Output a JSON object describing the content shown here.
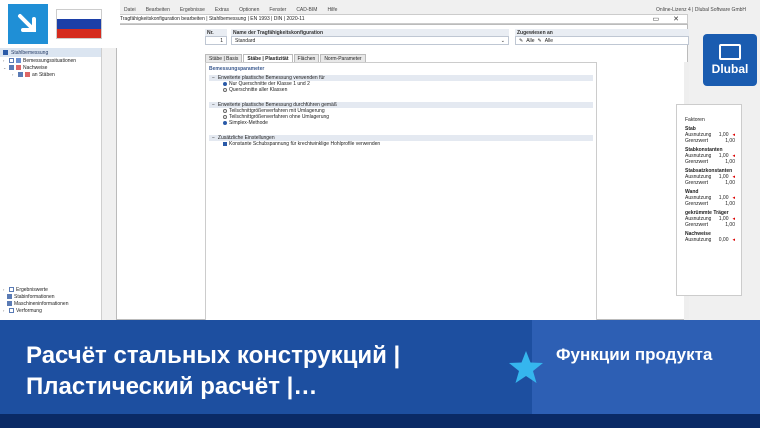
{
  "menubar": [
    "Datei",
    "Bearbeiten",
    "Ergebnisse",
    "Extras",
    "Optionen",
    "Fenster",
    "CAD-BIM",
    "Hilfe"
  ],
  "titlebar": {
    "title": "Tragfähigkeitskonfiguration bearbeiten | Stahlbemessung | EN 1993 | DIN | 2020-11",
    "license": "Online-Lizenz 4 | Dlubal Software GmbH"
  },
  "left_panel": {
    "header": "Stahlbemessung",
    "tree": [
      "Bemessungssituationen",
      "Nachweise",
      "an Stäben"
    ],
    "tree_bottom": [
      "Ergebniswerte",
      "Stabinformationen",
      "Maschineninformationen",
      "Verformung"
    ]
  },
  "dialog": {
    "no_label": "Nr.",
    "no_value": "1",
    "name_label": "Name der Tragfähigkeitskonfiguration",
    "name_value": "Standard",
    "assigned_label": "Zugewiesen an",
    "assigned_value": "Alle",
    "assigned_value2": "Alle",
    "tabs": [
      "Stäbe | Basis",
      "Stäbe | Plastizität",
      "Flächen",
      "Norm-Parameter"
    ],
    "section": "Bemessungsparameter",
    "groups": [
      {
        "title": "Erweiterte plastische Bemessung verwenden für",
        "options": [
          {
            "label": "Nur Querschnitte der Klasse 1 und 2",
            "on": true
          },
          {
            "label": "Querschnitte aller Klassen",
            "on": false
          }
        ]
      },
      {
        "title": "Erweiterte plastische Bemessung durchführen gemäß",
        "options": [
          {
            "label": "Teilschnittgrößenverfahren mit Umlagerung",
            "on": false
          },
          {
            "label": "Teilschnittgrößenverfahren ohne Umlagerung",
            "on": false
          },
          {
            "label": "Simplex-Methode",
            "on": true
          }
        ]
      }
    ],
    "extra_title": "Zusätzliche Einstellungen",
    "extra_check": "Konstante Schubspannung für krechtwinklige Hohlprofile verwenden"
  },
  "right_panel": {
    "title_line": "Faktoren",
    "groups": [
      {
        "name": "Stab",
        "rows": [
          [
            "Ausnutzung",
            "1,00"
          ],
          [
            "Grenzwert",
            "1,00"
          ]
        ]
      },
      {
        "name": "Stabkonstanten",
        "rows": [
          [
            "Ausnutzung",
            "1,00"
          ],
          [
            "Grenzwert",
            "1,00"
          ]
        ]
      },
      {
        "name": "Stabsatzkonstanten",
        "rows": [
          [
            "Ausnutzung",
            "1,00"
          ],
          [
            "Grenzwert",
            "1,00"
          ]
        ]
      },
      {
        "name": "Wand",
        "rows": [
          [
            "Ausnutzung",
            "1,00"
          ],
          [
            "Grenzwert",
            "1,00"
          ]
        ]
      },
      {
        "name": "gekrümmte Träger",
        "rows": [
          [
            "Ausnutzung",
            "1,00"
          ],
          [
            "Grenzwert",
            "1,00"
          ]
        ]
      },
      {
        "name": "Nachweise",
        "rows": [
          [
            "Ausnutzung",
            "0,00"
          ]
        ]
      }
    ]
  },
  "logo": {
    "text": "Dlubal"
  },
  "banner": {
    "title": "Расчёт стальных конструкций | Пластический расчёт |…",
    "subtitle": "Функции продукта"
  },
  "colors": {
    "banner_blue": "#1d4fa0",
    "banner_right": "#2d5fb4",
    "accent": "#1f8fd6",
    "star": "#35b6ee"
  }
}
